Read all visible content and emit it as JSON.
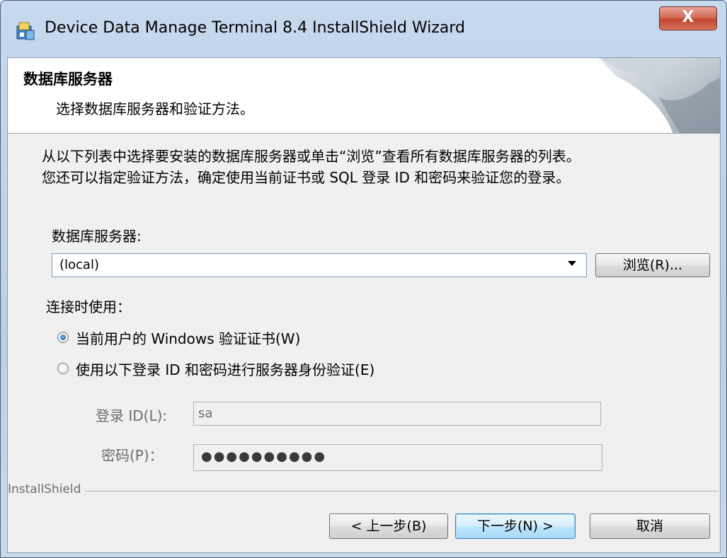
{
  "window": {
    "title": "Device Data Manage Terminal 8.4 InstallShield Wizard",
    "close_label": "X"
  },
  "banner": {
    "title": "数据库服务器",
    "subtitle": "选择数据库服务器和验证方法。"
  },
  "description": {
    "line1": "从以下列表中选择要安装的数据库服务器或单击“浏览”查看所有数据库服务器的列表。",
    "line2": "您还可以指定验证方法，确定使用当前证书或 SQL 登录 ID 和密码来验证您的登录。"
  },
  "server": {
    "label": "数据库服务器:",
    "value": "(local)",
    "browse_label": "浏览(R)..."
  },
  "connect": {
    "label": "连接时使用：",
    "options": [
      {
        "label": "当前用户的 Windows 验证证书(W)",
        "selected": true
      },
      {
        "label": "使用以下登录 ID 和密码进行服务器身份验证(E)",
        "selected": false
      }
    ]
  },
  "login": {
    "id_label": "登录 ID(L):",
    "id_value": "sa",
    "password_label": "密码(P)：",
    "password_value": "●●●●●●●●●●"
  },
  "footer": {
    "brand": "InstallShield",
    "back_label": "< 上一步(B)",
    "next_label": "下一步(N) >",
    "cancel_label": "取消"
  },
  "colors": {
    "title_bar": "#c6d9ee",
    "close_button": "#c0442e",
    "default_button": "#bee6fd",
    "dialog_bg": "#f0f0f0"
  },
  "icons": [
    "installer-icon",
    "close-icon",
    "dropdown-arrow-icon",
    "banner-page-curl-icon"
  ]
}
